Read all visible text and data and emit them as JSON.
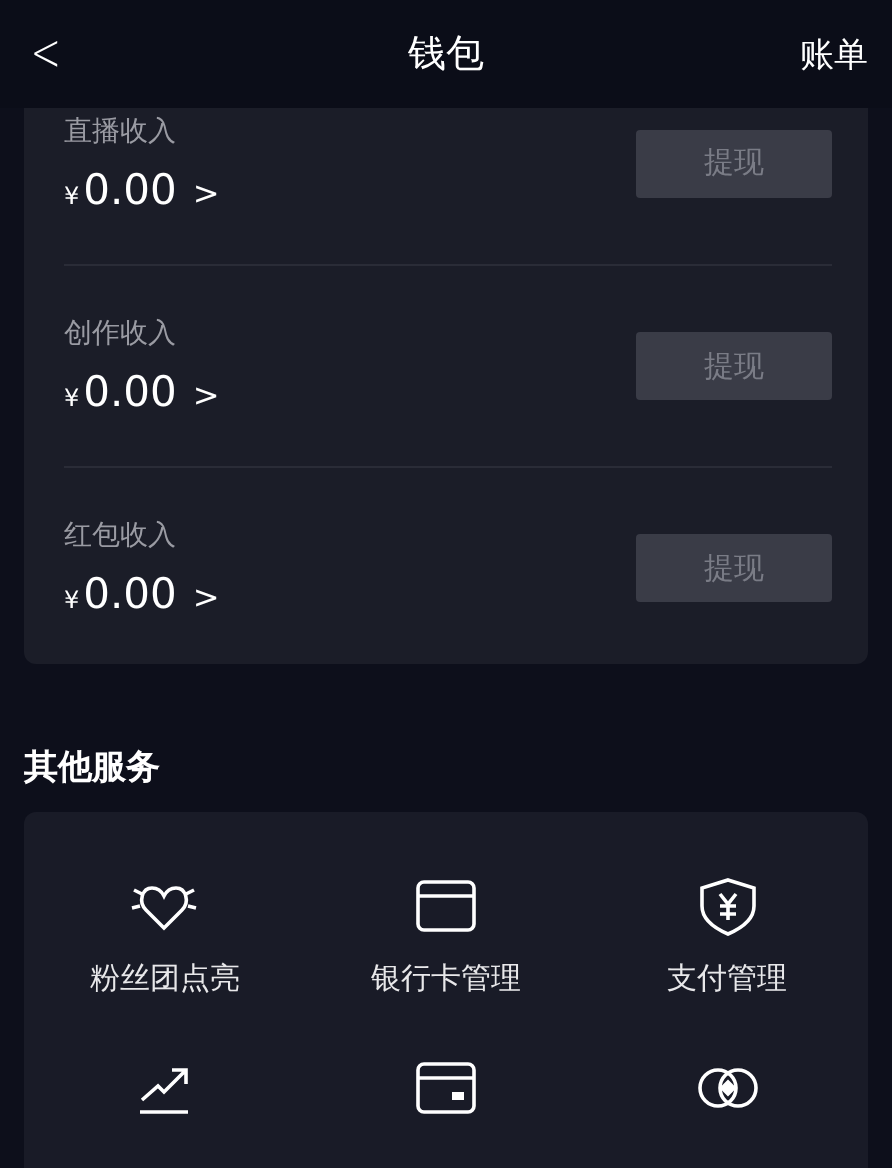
{
  "header": {
    "back": "<",
    "title": "钱包",
    "action": "账单"
  },
  "incomes": [
    {
      "label": "直播收入",
      "currency": "¥",
      "amount": "0.00",
      "arrow": ">",
      "button": "提现"
    },
    {
      "label": "创作收入",
      "currency": "¥",
      "amount": "0.00",
      "arrow": ">",
      "button": "提现"
    },
    {
      "label": "红包收入",
      "currency": "¥",
      "amount": "0.00",
      "arrow": ">",
      "button": "提现"
    }
  ],
  "section_title": "其他服务",
  "services": [
    {
      "label": "粉丝团点亮"
    },
    {
      "label": "银行卡管理"
    },
    {
      "label": "支付管理"
    }
  ]
}
